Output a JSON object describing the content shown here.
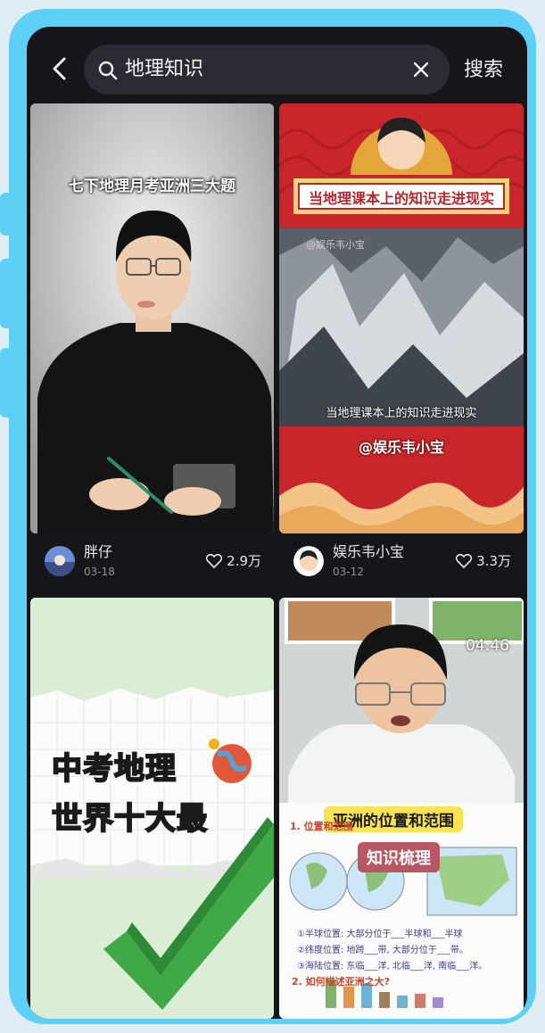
{
  "search": {
    "query": "地理知识",
    "button_label": "搜索"
  },
  "results": [
    {
      "overlay_title": "七下地理月考亚洲三大题",
      "author": "胖仔",
      "date": "03-18",
      "likes": "2.9万"
    },
    {
      "banner_title": "当地理课本上的知识走进现实",
      "watermark": "@娱乐韦小宝",
      "caption": "当地理课本上的知识走进现实",
      "handle": "@娱乐韦小宝",
      "author": "娱乐韦小宝",
      "date": "03-12",
      "likes": "3.3万"
    },
    {
      "title_line1": "中考地理",
      "title_line2": "世界十大最"
    },
    {
      "duration": "04:46",
      "title_label": "亚洲的位置和范围",
      "tag_label": "知识梳理",
      "note_heading1": "1. 位置和范围",
      "note_line1": "①半球位置: 大部分位于___半球和___半球",
      "note_line2": "②纬度位置: 地跨___带, 大部分位于___带。",
      "note_line3": "③海陆位置: 东临___洋, 北临___洋, 南临___洋。",
      "note_heading2": "2. 如何描述亚洲之大?"
    }
  ],
  "colors": {
    "frame": "#5ed0f7",
    "background": "#16161a",
    "search_box": "#2b2c33",
    "banner_red": "#c8262a",
    "banner_gold": "#f2d27a",
    "green_bg": "#dbeed5",
    "check_green": "#3fa847",
    "title_yellow": "#f7e354",
    "tag_red": "#b65763"
  }
}
